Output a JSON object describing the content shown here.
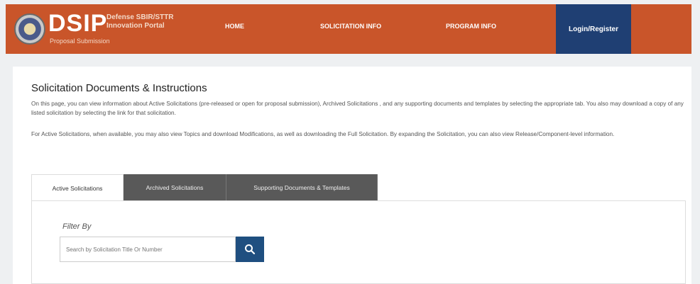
{
  "header": {
    "logo": "DSIP",
    "subtitle_line1": "Defense SBIR/STTR",
    "subtitle_line2": "Innovation Portal",
    "tagline": "Proposal Submission",
    "nav": [
      "HOME",
      "SOLICITATION INFO",
      "PROGRAM INFO"
    ],
    "login": "Login/Register",
    "color": "#c9552a",
    "login_color": "#1f3f73"
  },
  "main": {
    "title": "Solicitation Documents & Instructions",
    "para1": "On this page, you can view information about Active Solicitations (pre-released or open for proposal submission), Archived Solicitations , and any supporting documents and templates by selecting the appropriate tab. You also may download a copy of any listed solicitation by selecting the link for that solicitation.",
    "para2": "For Active Solicitations, when available, you may also view Topics and download Modifications, as well as downloading the Full Solicitation. By expanding the Solicitation, you can also view Release/Component-level information."
  },
  "tabs": [
    "Active Solicitations",
    "Archived Solicitations",
    "Supporting Documents & Templates"
  ],
  "filter": {
    "label": "Filter By",
    "placeholder": "Search by Solicitation Title Or Number",
    "button_icon": "search-icon"
  }
}
